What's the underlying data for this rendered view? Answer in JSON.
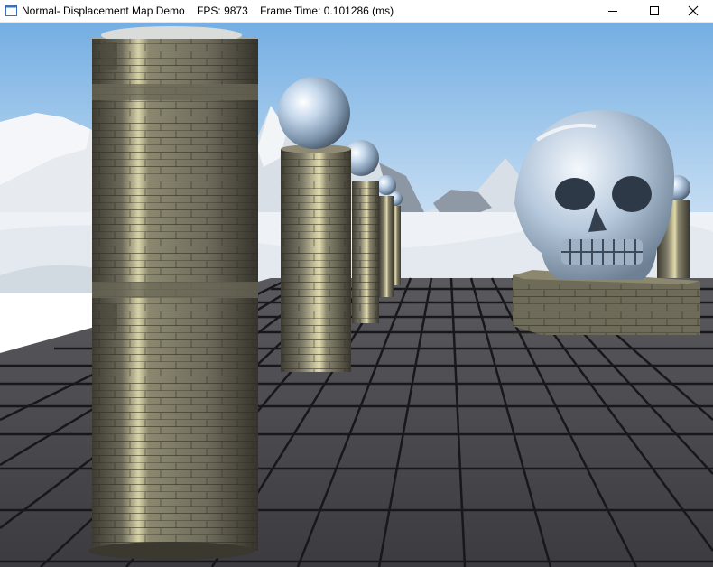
{
  "window": {
    "title": "Normal- Displacement Map Demo    FPS: 9873    Frame Time: 0.101286 (ms)",
    "controls": {
      "minimize": "minimize-icon",
      "maximize": "maximize-icon",
      "close": "close-icon"
    }
  },
  "scene": {
    "sky_top": "#7fb2e4",
    "sky_bottom": "#e6f0fa",
    "snow": "#eef2f6",
    "floor_tile": "#4a4a4e",
    "floor_grout": "#141416",
    "stone": "#7d7a6a",
    "chrome": "#c7d8ea"
  }
}
